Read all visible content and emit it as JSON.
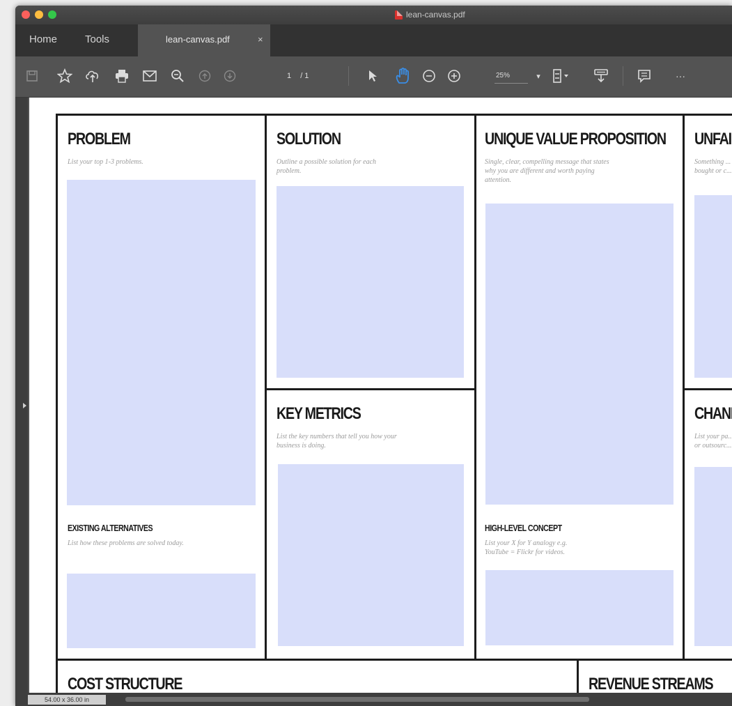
{
  "window": {
    "title": "lean-canvas.pdf"
  },
  "tabs": {
    "home": "Home",
    "tools": "Tools",
    "document": "lean-canvas.pdf",
    "close": "×"
  },
  "toolbar": {
    "icons": [
      "save-icon",
      "bookmark-star-icon",
      "upload-cloud-icon",
      "print-icon",
      "email-icon",
      "zoom-search-icon",
      "page-up-icon",
      "page-down-icon",
      "select-arrow-icon",
      "hand-tool-icon",
      "zoom-out-icon",
      "zoom-in-icon",
      "fit-page-icon",
      "comment-stamp-icon",
      "comment-icon",
      "more-icon"
    ],
    "page_current": "1",
    "page_total": "/ 1",
    "zoom": "25%",
    "more": "···"
  },
  "canvas": {
    "problem": {
      "title": "PROBLEM",
      "desc": "List your top 1-3 problems."
    },
    "existing_alternatives": {
      "title": "EXISTING ALTERNATIVES",
      "desc": "List how these problems are solved today."
    },
    "solution": {
      "title": "SOLUTION",
      "desc": "Outline a possible solution for each problem."
    },
    "key_metrics": {
      "title": "KEY METRICS",
      "desc": "List the key numbers that tell you how your business is doing."
    },
    "uvp": {
      "title": "UNIQUE VALUE PROPOSITION",
      "desc": "Single, clear, compelling message that states why you are different and worth paying attention."
    },
    "high_level_concept": {
      "title": "HIGH-LEVEL CONCEPT",
      "desc": "List your X for Y analogy e.g. YouTube = Flickr for videos."
    },
    "unfair_advantage": {
      "title": "UNFAI",
      "desc": "Something ... bought or c..."
    },
    "channels": {
      "title": "CHANI",
      "desc": "List your pa... or outsourc..."
    },
    "cost_structure": {
      "title": "COST STRUCTURE"
    },
    "revenue_streams": {
      "title": "REVENUE STREAMS"
    }
  },
  "status": {
    "page_size": "54.00 x 36.00 in"
  },
  "colors": {
    "fill": "#d8defa",
    "border": "#1c1c1c",
    "chrome": "#535353",
    "accent_blue": "#3a8ee6"
  }
}
